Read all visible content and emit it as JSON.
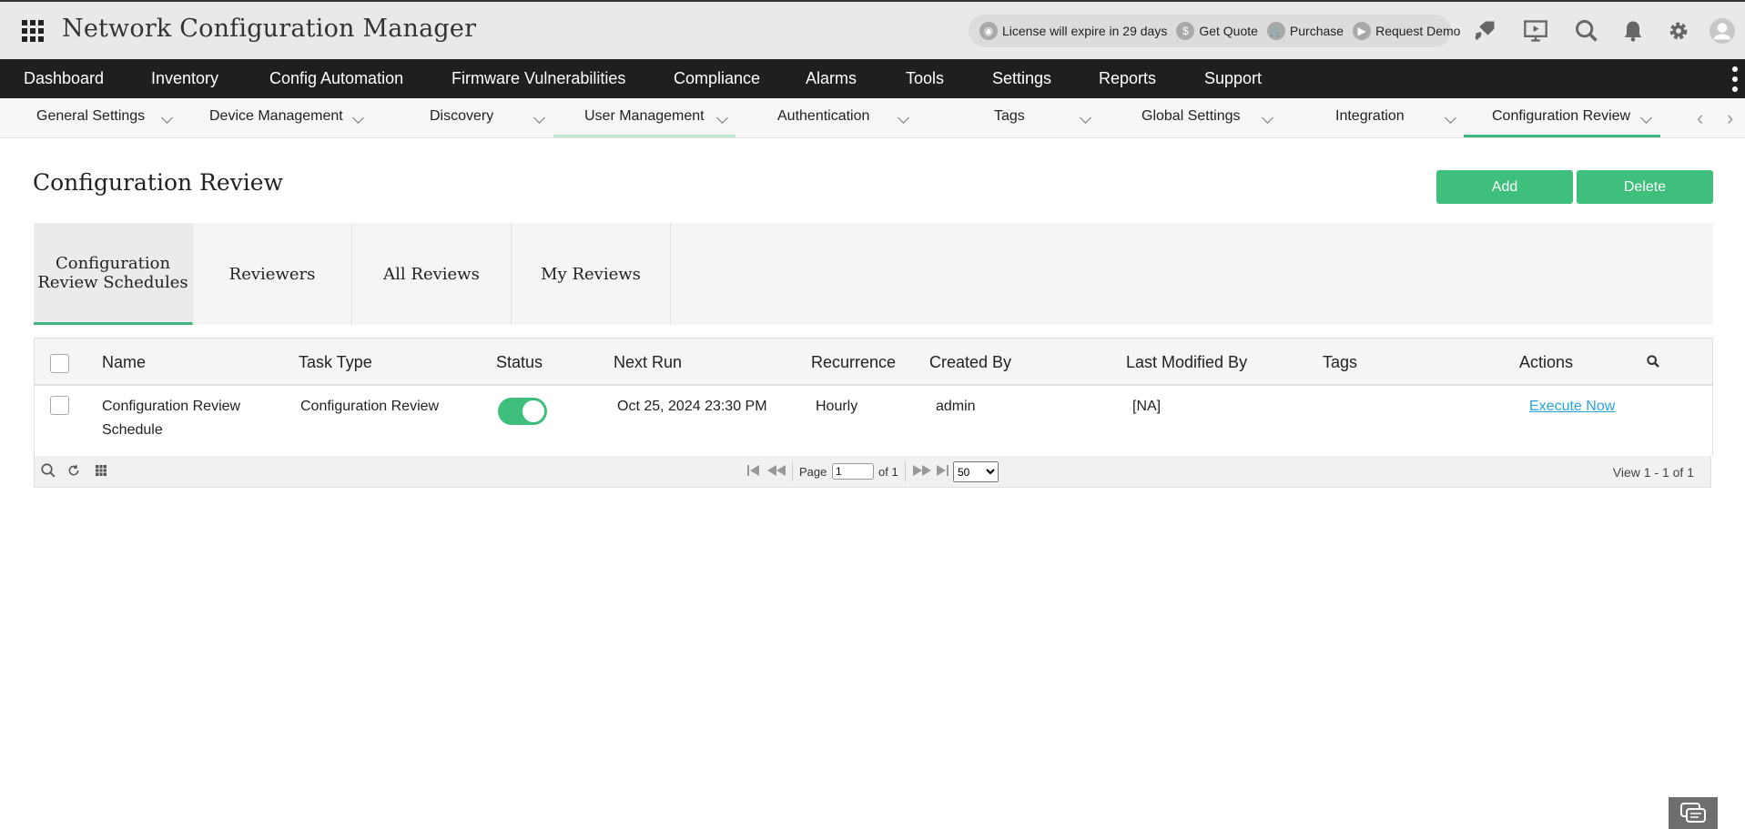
{
  "header": {
    "title": "Network Configuration Manager",
    "license": {
      "expiry": "License will expire in 29 days",
      "get_quote": "Get Quote",
      "purchase": "Purchase",
      "request_demo": "Request Demo"
    }
  },
  "mainnav": {
    "items": [
      "Dashboard",
      "Inventory",
      "Config Automation",
      "Firmware Vulnerabilities",
      "Compliance",
      "Alarms",
      "Tools",
      "Settings",
      "Reports",
      "Support"
    ]
  },
  "subnav": {
    "items": [
      "General Settings",
      "Device Management",
      "Discovery",
      "User Management",
      "Authentication",
      "Tags",
      "Global Settings",
      "Integration",
      "Configuration Review"
    ]
  },
  "page": {
    "title": "Configuration Review",
    "add_label": "Add",
    "delete_label": "Delete"
  },
  "tabs": [
    "Configuration Review Schedules",
    "Reviewers",
    "All Reviews",
    "My Reviews"
  ],
  "table": {
    "columns": [
      "Name",
      "Task Type",
      "Status",
      "Next Run",
      "Recurrence",
      "Created By",
      "Last Modified By",
      "Tags",
      "Actions"
    ],
    "rows": [
      {
        "name": "Configuration Review Schedule",
        "task_type": "Configuration Review",
        "status_enabled": true,
        "next_run": "Oct 25, 2024 23:30 PM",
        "recurrence": "Hourly",
        "created_by": "admin",
        "last_modified_by": "[NA]",
        "tags": "",
        "action": "Execute Now"
      }
    ]
  },
  "pager": {
    "page_label": "Page",
    "page_value": "1",
    "of_label": "of 1",
    "page_size": "50",
    "view_text": "View 1 - 1 of 1"
  },
  "colors": {
    "accent": "#3fbf7c",
    "link": "#27a3de",
    "nav_bg": "#1f1f1f"
  }
}
